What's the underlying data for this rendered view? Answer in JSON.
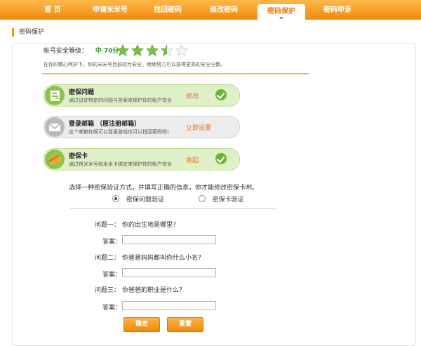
{
  "nav": {
    "items": [
      {
        "label": "首  页",
        "active": false
      },
      {
        "label": "申请米米号",
        "active": false
      },
      {
        "label": "找回密码",
        "active": false
      },
      {
        "label": "修改密码",
        "active": false
      },
      {
        "label": "密码保护",
        "active": true
      },
      {
        "label": "密码申诉",
        "active": false
      }
    ]
  },
  "section_title": "密码保护",
  "security": {
    "label": "帐号安全等级：",
    "value": "中  70分",
    "rating": 3.5,
    "max_rating": 5,
    "tip": "在你的精心呵护下，你的米米号目前较为安全，继续努力可以获得更高的安全分数。"
  },
  "items": [
    {
      "title": "密保问题",
      "desc": "通过设定特定的问题与答案来保护你的账户安全",
      "action": "修改",
      "checked": true,
      "style": "green"
    },
    {
      "title": "登录邮箱 （原注册邮箱）",
      "desc": "这个邮箱你既可以登录游戏也可以找回密码哟！",
      "action": "立即设置",
      "checked": false,
      "style": "gray"
    },
    {
      "title": "密保卡",
      "desc": "通过将米米号和米米卡绑定来保护你的账户安全",
      "action": "收起",
      "checked": true,
      "style": "green"
    }
  ],
  "verify": {
    "prompt": "选择一种密保验证方式，并填写正确的信息，你才能修改密保卡哟。",
    "options": [
      "密保问题验证",
      "密保卡验证"
    ],
    "selected": 0,
    "questions": [
      {
        "label": "问题一：",
        "text": "你的出生地是哪里？"
      },
      {
        "label": "问题二：",
        "text": "你爸爸妈妈都叫你什么小名？"
      },
      {
        "label": "问题三：",
        "text": "你爸爸的职业是什么？"
      }
    ],
    "answer_label": "答案：",
    "answers": [
      "",
      "",
      ""
    ]
  },
  "buttons": {
    "confirm": "确定",
    "reset": "重置"
  },
  "colors": {
    "accent": "#f39800",
    "success": "#6bb52e",
    "action_text": "#e3711b"
  },
  "icons": {
    "question": "question-card-icon",
    "mail": "envelope-icon",
    "card": "card-icon",
    "check": "check-icon",
    "star": "star-icon"
  }
}
